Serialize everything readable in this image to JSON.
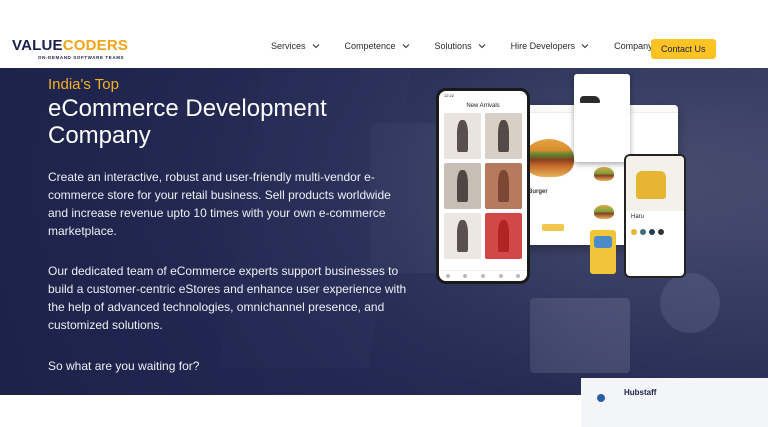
{
  "logo": {
    "text_main": "VALUE",
    "text_accent": "CODERS",
    "tagline": "ON-DEMAND SOFTWARE TEAMS"
  },
  "nav": {
    "items": [
      {
        "label": "Services"
      },
      {
        "label": "Competence"
      },
      {
        "label": "Solutions"
      },
      {
        "label": "Hire Developers"
      },
      {
        "label": "Company"
      }
    ],
    "cta_label": "Contact Us"
  },
  "hero": {
    "eyebrow": "India's Top",
    "title": "eCommerce Development Company",
    "paragraph1": "Create an interactive, robust and user-friendly multi-vendor e-commerce store for your retail business. Sell products worldwide and increase revenue upto 10 times with your own e-commerce marketplace.",
    "paragraph2": "Our dedicated team of eCommerce experts support businesses to build a customer-centric eStores and enhance user experience with the help of advanced technologies, omnichannel presence, and customized solutions.",
    "paragraph3": "So what are you waiting for?"
  },
  "mockup": {
    "phone_title": "New Arrivals",
    "phone_status": "12:22",
    "burger_label": "Burger",
    "chair_label": "Haru"
  },
  "bottom_card": {
    "text": "Hubstaff"
  },
  "colors": {
    "accent": "#fcc322",
    "eyebrow": "#f5b323",
    "navy": "#1b1f4a"
  }
}
